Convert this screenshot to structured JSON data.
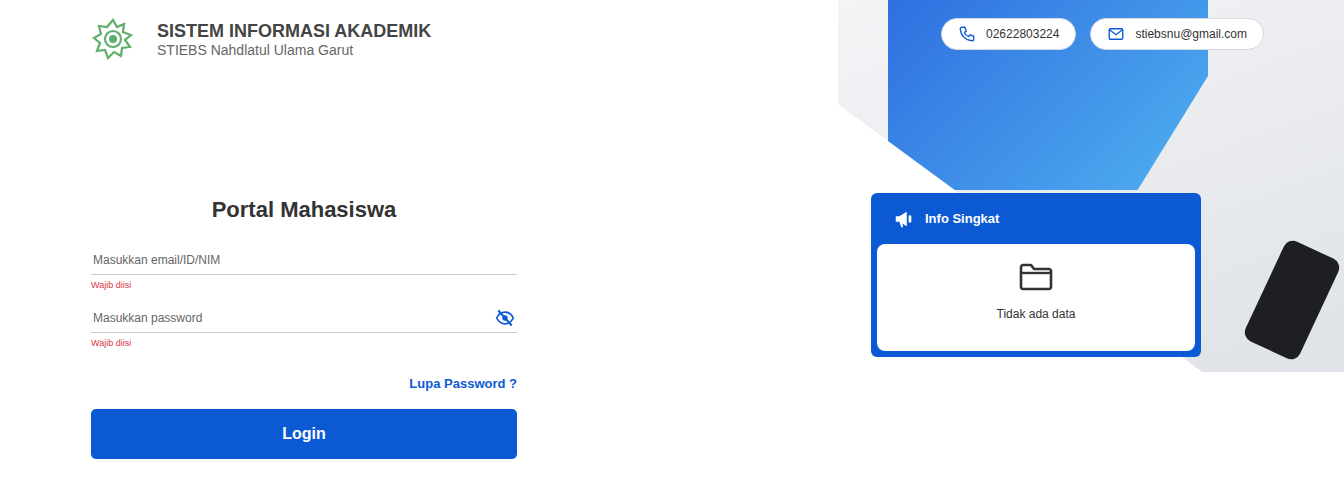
{
  "header": {
    "title": "SISTEM INFORMASI AKADEMIK",
    "subtitle": "STIEBS Nahdlatul Ulama Garut"
  },
  "contacts": [
    {
      "kind": "phone",
      "text": "02622803224"
    },
    {
      "kind": "email",
      "text": "stiebsnu@gmail.com"
    }
  ],
  "login": {
    "title": "Portal Mahasiswa",
    "fields": [
      {
        "kind": "text",
        "placeholder": "Masukkan email/ID/NIM",
        "error": "Wajib diisi",
        "password_visible": false
      },
      {
        "kind": "password",
        "placeholder": "Masukkan password",
        "error": "Wajib diisi",
        "password_visible": false
      }
    ],
    "forgot": "Lupa Password ?",
    "button": "Login"
  },
  "info": {
    "title": "Info Singkat",
    "empty": "Tidak ada data"
  }
}
